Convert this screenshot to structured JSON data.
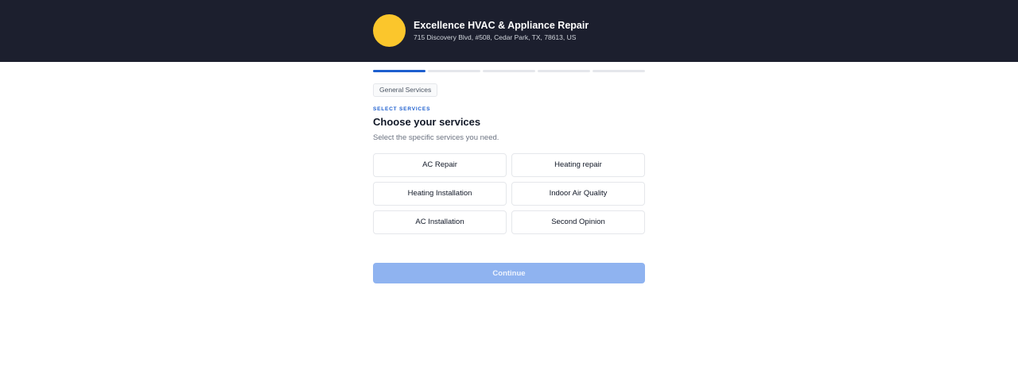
{
  "business": {
    "name": "Excellence HVAC & Appliance Repair",
    "address": "715 Discovery Blvd, #508, Cedar Park, TX, 78613, US",
    "logo_color": "#fbc62c"
  },
  "progress": {
    "current_step": 1,
    "total_steps": 5
  },
  "category_chip": "General Services",
  "step": {
    "eyebrow": "SELECT SERVICES",
    "title": "Choose your services",
    "subtitle": "Select the specific services you need."
  },
  "services": [
    {
      "label": "AC Repair"
    },
    {
      "label": "Heating repair"
    },
    {
      "label": "Heating Installation"
    },
    {
      "label": "Indoor Air Quality"
    },
    {
      "label": "AC Installation"
    },
    {
      "label": "Second Opinion"
    }
  ],
  "continue_label": "Continue",
  "colors": {
    "header_bg": "#1c1f2e",
    "accent": "#1d5fcf",
    "button_disabled": "#8fb3f0"
  }
}
